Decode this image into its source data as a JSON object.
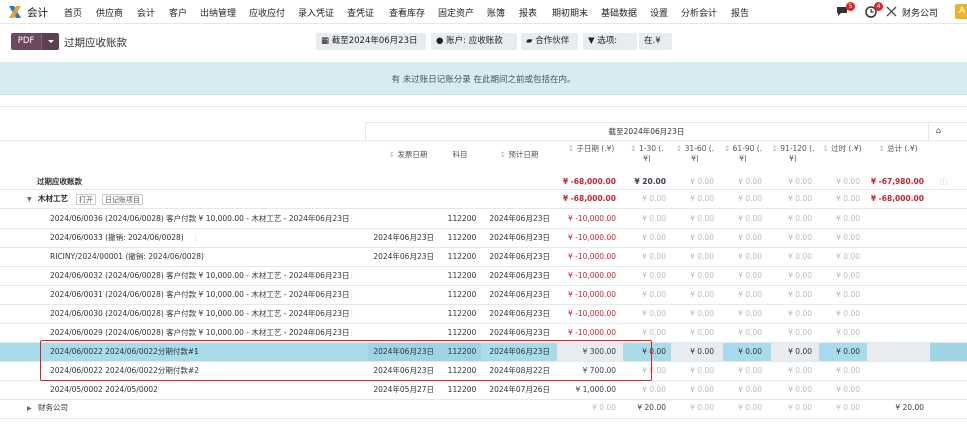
{
  "nav": {
    "brand": "会计",
    "menu": [
      "首页",
      "供应商",
      "会计",
      "客户",
      "出纳管理",
      "应收应付",
      "录入凭证",
      "查凭证",
      "查看库存",
      "固定资产",
      "账簿",
      "报表",
      "期初期末",
      "基础数据",
      "设置",
      "分析会计",
      "报告"
    ],
    "msg_count": "5",
    "activity_count": "4",
    "company": "财务公司",
    "avatar": "A"
  },
  "controls": {
    "pdf": "PDF",
    "title": "过期应收账款",
    "date_filter": "截至2024年06月23日",
    "account_filter": "账户: 应收账款",
    "partner_filter": "合作伙伴",
    "options_filter": "选项:",
    "currency_filter": "在.¥"
  },
  "banner": {
    "text": "有 未过账日记账分录 在此期间之前或包括在内。"
  },
  "table": {
    "period_header": "截至2024年06月23日",
    "section_label": "过期应收账款",
    "headers": {
      "invoice_date": "发票日期",
      "account": "科目",
      "expected_date": "预计日期",
      "as_of": "于日期 (.¥)",
      "d1_30": "1-30 (.¥)",
      "d31_60": "31-60 (.¥)",
      "d61_90": "61-90 (.¥)",
      "d91_120": "91-120 (.¥)",
      "older": "过时 (.¥)",
      "total": "总计 (.¥)"
    },
    "summary": {
      "as_of": "¥ -68,000.00",
      "d1_30": "¥ 20.00",
      "d31_60": "¥ 0.00",
      "d61_90": "¥ 0.00",
      "d91_120": "¥ 0.00",
      "older": "¥ 0.00",
      "total": "¥ -67,980.00"
    },
    "group1": {
      "name": "木材工艺",
      "open": "打开",
      "journal": "日记账项目",
      "as_of": "¥ -68,000.00",
      "d1_30": "¥ 0.00",
      "d31_60": "¥ 0.00",
      "d61_90": "¥ 0.00",
      "d91_120": "¥ 0.00",
      "older": "¥ 0.00",
      "total": "¥ -68,000.00"
    },
    "rows": [
      {
        "label": "2024/06/0036 (2024/06/0028) 客户付款 ¥ 10,000.00 - 木材工艺 - 2024年06月23日",
        "inv_date": "",
        "account": "112200",
        "exp_date": "2024年06月23日",
        "as_of": "¥ -10,000.00",
        "d1_30": "¥ 0.00",
        "d31_60": "¥ 0.00",
        "d61_90": "¥ 0.00",
        "d91_120": "¥ 0.00",
        "older": "¥ 0.00"
      },
      {
        "label": "2024/06/0033 (撤销: 2024/06/0028)",
        "inv_date": "2024年06月23日",
        "account": "112200",
        "exp_date": "2024年06月23日",
        "as_of": "¥ -10,000.00",
        "d1_30": "¥ 0.00",
        "d31_60": "¥ 0.00",
        "d61_90": "¥ 0.00",
        "d91_120": "¥ 0.00",
        "older": "¥ 0.00"
      },
      {
        "label": "RICINY/2024/00001 (撤销: 2024/06/0028)",
        "inv_date": "2024年06月23日",
        "account": "112200",
        "exp_date": "2024年06月23日",
        "as_of": "¥ -10,000.00",
        "d1_30": "¥ 0.00",
        "d31_60": "¥ 0.00",
        "d61_90": "¥ 0.00",
        "d91_120": "¥ 0.00",
        "older": "¥ 0.00"
      },
      {
        "label": "2024/06/0032 (2024/06/0028) 客户付款 ¥ 10,000.00 - 木材工艺 - 2024年06月23日",
        "inv_date": "",
        "account": "112200",
        "exp_date": "2024年06月23日",
        "as_of": "¥ -10,000.00",
        "d1_30": "¥ 0.00",
        "d31_60": "¥ 0.00",
        "d61_90": "¥ 0.00",
        "d91_120": "¥ 0.00",
        "older": "¥ 0.00"
      },
      {
        "label": "2024/06/0031 (2024/06/0028) 客户付款 ¥ 10,000.00 - 木材工艺 - 2024年06月23日",
        "inv_date": "",
        "account": "112200",
        "exp_date": "2024年06月23日",
        "as_of": "¥ -10,000.00",
        "d1_30": "¥ 0.00",
        "d31_60": "¥ 0.00",
        "d61_90": "¥ 0.00",
        "d91_120": "¥ 0.00",
        "older": "¥ 0.00"
      },
      {
        "label": "2024/06/0030 (2024/06/0028) 客户付款 ¥ 10,000.00 - 木材工艺 - 2024年06月23日",
        "inv_date": "",
        "account": "112200",
        "exp_date": "2024年06月23日",
        "as_of": "¥ -10,000.00",
        "d1_30": "¥ 0.00",
        "d31_60": "¥ 0.00",
        "d61_90": "¥ 0.00",
        "d91_120": "¥ 0.00",
        "older": "¥ 0.00"
      },
      {
        "label": "2024/06/0029 (2024/06/0028) 客户付款 ¥ 10,000.00 - 木材工艺 - 2024年06月23日",
        "inv_date": "",
        "account": "112200",
        "exp_date": "2024年06月23日",
        "as_of": "¥ -10,000.00",
        "d1_30": "¥ 0.00",
        "d31_60": "¥ 0.00",
        "d61_90": "¥ 0.00",
        "d91_120": "¥ 0.00",
        "older": "¥ 0.00"
      },
      {
        "label": "2024/06/0022 2024/06/0022分期付款#1",
        "inv_date": "2024年06月23日",
        "account": "112200",
        "exp_date": "2024年06月23日",
        "as_of": "¥ 300.00",
        "d1_30": "¥ 0.00",
        "d31_60": "¥ 0.00",
        "d61_90": "¥ 0.00",
        "d91_120": "¥ 0.00",
        "older": "¥ 0.00"
      },
      {
        "label": "2024/06/0022 2024/06/0022分期付款#2",
        "inv_date": "2024年06月23日",
        "account": "112200",
        "exp_date": "2024年08月22日",
        "as_of": "¥ 700.00",
        "d1_30": "¥ 0.00",
        "d31_60": "¥ 0.00",
        "d61_90": "¥ 0.00",
        "d91_120": "¥ 0.00",
        "older": "¥ 0.00"
      },
      {
        "label": "2024/05/0002 2024/05/0002",
        "inv_date": "2024年05月27日",
        "account": "112200",
        "exp_date": "2024年07月26日",
        "as_of": "¥ 1,000.00",
        "d1_30": "¥ 0.00",
        "d31_60": "¥ 0.00",
        "d61_90": "¥ 0.00",
        "d91_120": "¥ 0.00",
        "older": "¥ 0.00"
      }
    ],
    "group2": {
      "name": "财务公司",
      "as_of": "¥ 0.00",
      "d1_30": "¥ 20.00",
      "d31_60": "¥ 0.00",
      "d61_90": "¥ 0.00",
      "d91_120": "¥ 0.00",
      "older": "¥ 0.00",
      "total": "¥ 20.00"
    }
  }
}
